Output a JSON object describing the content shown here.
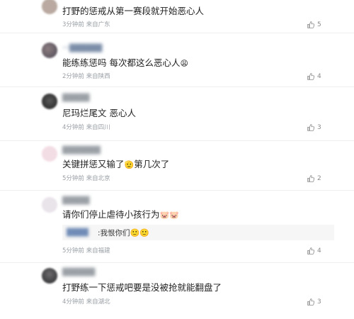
{
  "comments": [
    {
      "text": "打野的惩戒从第一赛段就开始恶心人",
      "meta": "3分钟前 来自广东",
      "likes": "5",
      "username": "████"
    },
    {
      "text": "能练练惩吗 每次都这么恶心人",
      "emoji": "😩",
      "meta": "2分钟前 来自陕西",
      "likes": "4",
      "username": "一██████"
    },
    {
      "text": "尼玛烂尾文 恶心人",
      "meta": "4分钟前 来自四川",
      "likes": "3",
      "username": "█████"
    },
    {
      "text": "关键拼惩又输了",
      "emoji": "🫡",
      "text_after": "第几次了",
      "meta": "5分钟前 来自北京",
      "likes": "2",
      "username": "███████"
    },
    {
      "text": "请你们停止虐待小孩行为",
      "emoji": "🐷🐷",
      "reply": {
        "username": "████",
        "text": ":我恨你们",
        "emoji": "🙂🙂"
      },
      "meta": "5分钟前 来自福建",
      "likes": "4",
      "username": "█████"
    },
    {
      "text": "打野练一下惩戒吧要是没被抢就能翻盘了",
      "meta": "4分钟前 来自湖北",
      "likes": "3",
      "username": "██████"
    }
  ],
  "colors": {
    "text": "#1f1f1f",
    "meta": "#9aa0a6",
    "divider": "#eeeeee"
  }
}
